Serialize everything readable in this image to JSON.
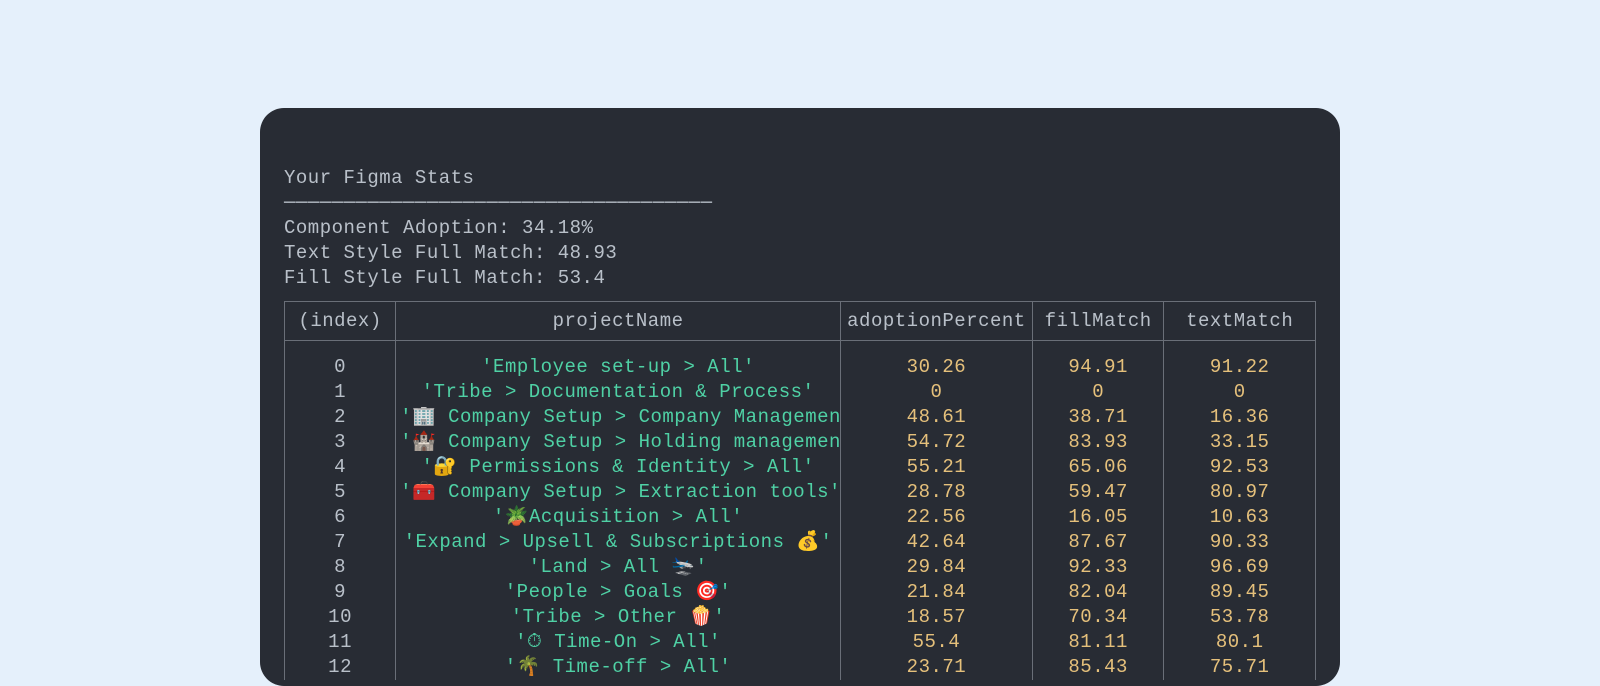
{
  "header": {
    "title": "Your Figma Stats",
    "divider": "────────────────────────────────────",
    "stat1_label": "Component Adoption: ",
    "stat1_value": "34.18%",
    "stat2_label": "Text Style Full Match: ",
    "stat2_value": "48.93",
    "stat3_label": "Fill Style Full Match: ",
    "stat3_value": "53.4"
  },
  "columns": {
    "index": "(index)",
    "projectName": "projectName",
    "adoptionPercent": "adoptionPercent",
    "fillMatch": "fillMatch",
    "textMatch": "textMatch"
  },
  "rows": [
    {
      "index": "0",
      "projectName": "'Employee set-up > All'",
      "adoptionPercent": "30.26",
      "fillMatch": "94.91",
      "textMatch": "91.22"
    },
    {
      "index": "1",
      "projectName": "'Tribe > Documentation & Process'",
      "adoptionPercent": "0",
      "fillMatch": "0",
      "textMatch": "0"
    },
    {
      "index": "2",
      "projectName": "'🏢 Company Setup > Company Management'",
      "adoptionPercent": "48.61",
      "fillMatch": "38.71",
      "textMatch": "16.36"
    },
    {
      "index": "3",
      "projectName": "'🏰 Company Setup > Holding management'",
      "adoptionPercent": "54.72",
      "fillMatch": "83.93",
      "textMatch": "33.15"
    },
    {
      "index": "4",
      "projectName": "'🔐 Permissions & Identity > All'",
      "adoptionPercent": "55.21",
      "fillMatch": "65.06",
      "textMatch": "92.53"
    },
    {
      "index": "5",
      "projectName": "'🧰 Company Setup > Extraction tools'",
      "adoptionPercent": "28.78",
      "fillMatch": "59.47",
      "textMatch": "80.97"
    },
    {
      "index": "6",
      "projectName": "'🪴Acquisition > All'",
      "adoptionPercent": "22.56",
      "fillMatch": "16.05",
      "textMatch": "10.63"
    },
    {
      "index": "7",
      "projectName": "'Expand > Upsell & Subscriptions 💰'",
      "adoptionPercent": "42.64",
      "fillMatch": "87.67",
      "textMatch": "90.33"
    },
    {
      "index": "8",
      "projectName": "'Land > All 🛬'",
      "adoptionPercent": "29.84",
      "fillMatch": "92.33",
      "textMatch": "96.69"
    },
    {
      "index": "9",
      "projectName": "'People > Goals 🎯'",
      "adoptionPercent": "21.84",
      "fillMatch": "82.04",
      "textMatch": "89.45"
    },
    {
      "index": "10",
      "projectName": "'Tribe > Other 🍿'",
      "adoptionPercent": "18.57",
      "fillMatch": "70.34",
      "textMatch": "53.78"
    },
    {
      "index": "11",
      "projectName": "'⏱ Time-On > All'",
      "adoptionPercent": "55.4",
      "fillMatch": "81.11",
      "textMatch": "80.1"
    },
    {
      "index": "12",
      "projectName": "'🌴 Time-off > All'",
      "adoptionPercent": "23.71",
      "fillMatch": "85.43",
      "textMatch": "75.71"
    }
  ]
}
